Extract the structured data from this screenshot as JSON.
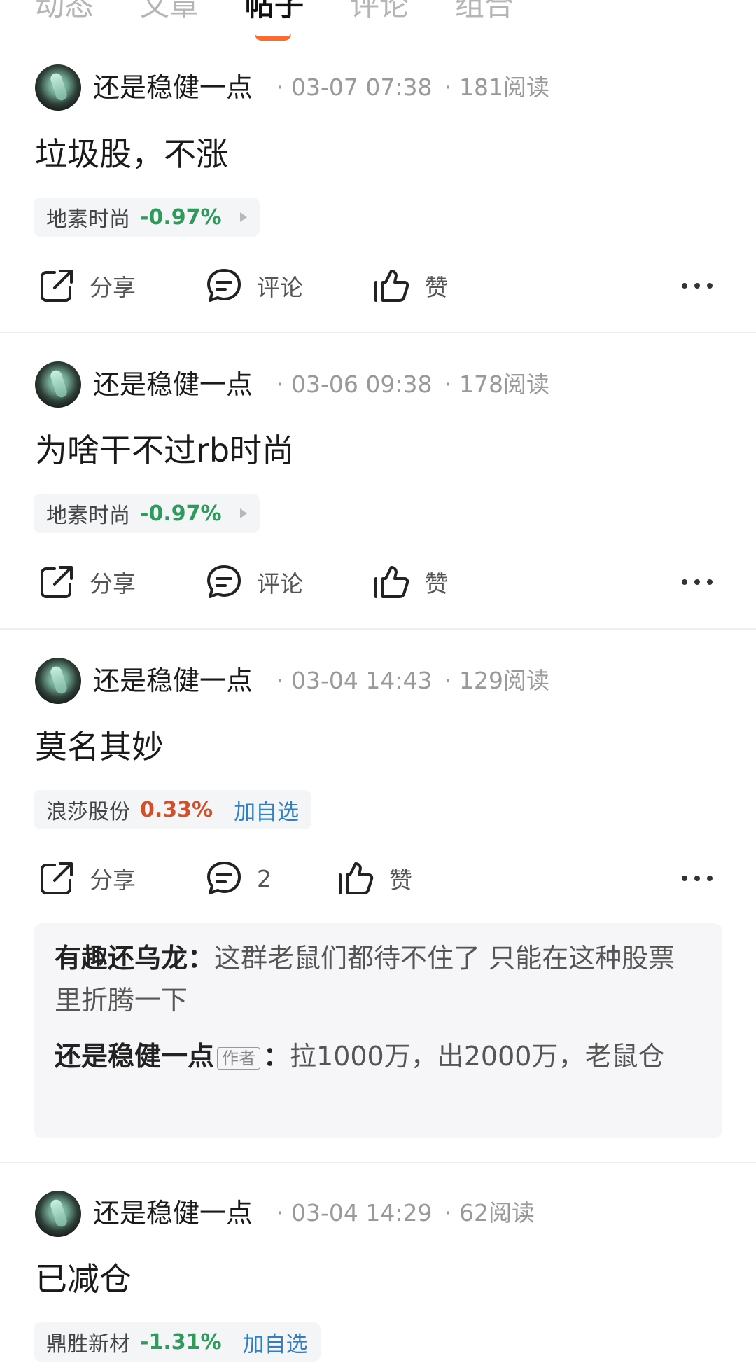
{
  "tabs": [
    "动态",
    "文章",
    "帖子",
    "评论",
    "组合"
  ],
  "active_tab": "帖子",
  "colors": {
    "accent": "#ff6a2a",
    "down": "#2f9a5c",
    "up": "#d1502c",
    "link": "#2f7fc2"
  },
  "posts": [
    {
      "author": "还是稳健一点",
      "time": "· 03-07 07:38",
      "reads": "· 181阅读",
      "content": "垃圾股，不涨",
      "stock": {
        "name": "地素时尚",
        "change": "-0.97%"
      },
      "actions": {
        "share": "分享",
        "comment": "评论",
        "like": "赞"
      }
    },
    {
      "author": "还是稳健一点",
      "time": "· 03-06 09:38",
      "reads": "· 178阅读",
      "content": "为啥干不过rb时尚",
      "stock": {
        "name": "地素时尚",
        "change": "-0.97%"
      },
      "actions": {
        "share": "分享",
        "comment": "评论",
        "like": "赞"
      }
    },
    {
      "author": "还是稳健一点",
      "time": "· 03-04 14:43",
      "reads": "· 129阅读",
      "content": "莫名其妙",
      "stock": {
        "name": "浪莎股份",
        "change": "0.33%",
        "add_label": "加自选"
      },
      "actions": {
        "share": "分享",
        "comment": "2",
        "like": "赞"
      },
      "comments": [
        {
          "user": "有趣还乌龙",
          "text": "这群老鼠们都待不住了 只能在这种股票里折腾一下"
        },
        {
          "user": "还是稳健一点",
          "tag": "作者",
          "text": "拉1000万，出2000万，老鼠仓"
        }
      ]
    },
    {
      "author": "还是稳健一点",
      "time": "· 03-04 14:29",
      "reads": "· 62阅读",
      "content": "已减仓",
      "stock": {
        "name": "鼎胜新材",
        "change": "-1.31%",
        "add_label": "加自选"
      }
    }
  ]
}
